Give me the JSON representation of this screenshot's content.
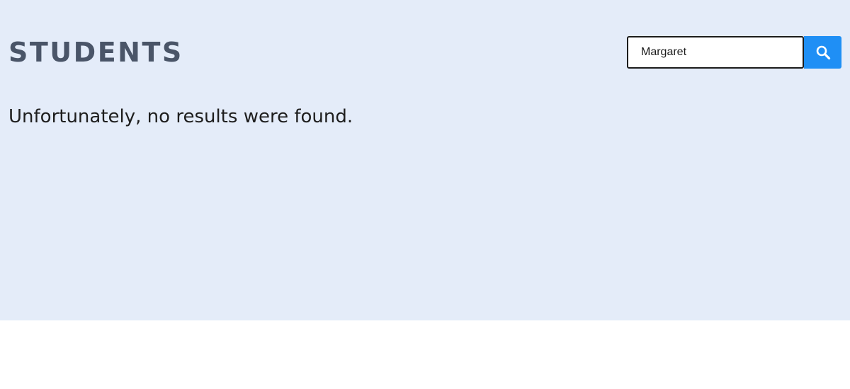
{
  "header": {
    "title": "STUDENTS"
  },
  "search": {
    "value": "Margaret",
    "button_icon": "search-icon"
  },
  "results": {
    "message": "Unfortunately, no results were found."
  },
  "colors": {
    "panel_background": "#e4ecf9",
    "title": "#4a5568",
    "search_button": "#1f8ff5"
  }
}
